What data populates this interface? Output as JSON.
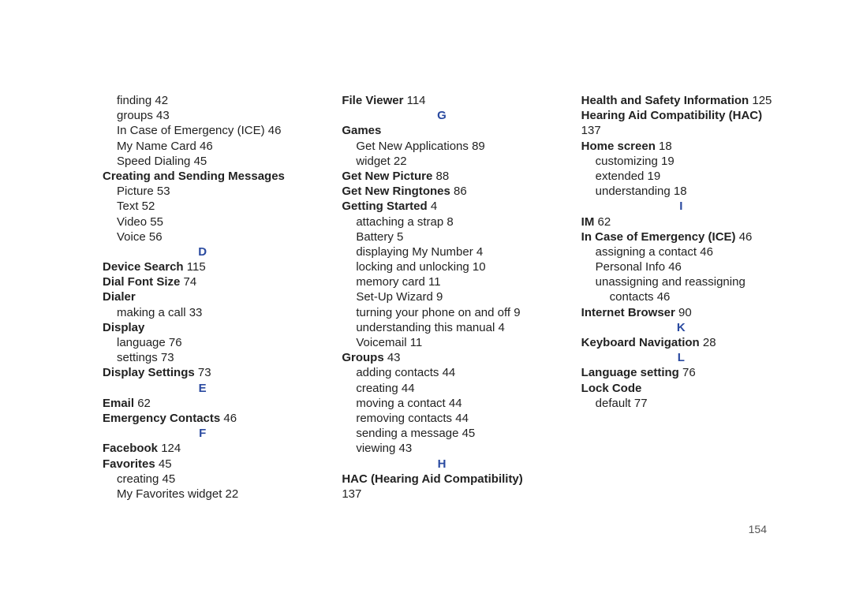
{
  "page_number": "154",
  "lines": [
    {
      "indent": 1,
      "bold": false,
      "letter": false,
      "text": "finding",
      "page": "42"
    },
    {
      "indent": 1,
      "bold": false,
      "letter": false,
      "text": "groups",
      "page": "43"
    },
    {
      "indent": 1,
      "bold": false,
      "letter": false,
      "text": "In Case of Emergency (ICE)",
      "page": "46"
    },
    {
      "indent": 1,
      "bold": false,
      "letter": false,
      "text": "My Name Card",
      "page": "46"
    },
    {
      "indent": 1,
      "bold": false,
      "letter": false,
      "text": "Speed Dialing",
      "page": "45"
    },
    {
      "indent": 0,
      "bold": true,
      "letter": false,
      "text": "Creating and Sending Messages",
      "page": ""
    },
    {
      "indent": 1,
      "bold": false,
      "letter": false,
      "text": "Picture",
      "page": "53"
    },
    {
      "indent": 1,
      "bold": false,
      "letter": false,
      "text": "Text",
      "page": "52"
    },
    {
      "indent": 1,
      "bold": false,
      "letter": false,
      "text": "Video",
      "page": "55"
    },
    {
      "indent": 1,
      "bold": false,
      "letter": false,
      "text": "Voice",
      "page": "56"
    },
    {
      "indent": 0,
      "bold": true,
      "letter": true,
      "text": "D",
      "page": ""
    },
    {
      "indent": 0,
      "bold": true,
      "letter": false,
      "text": "Device Search",
      "page": "115"
    },
    {
      "indent": 0,
      "bold": true,
      "letter": false,
      "text": "Dial Font Size",
      "page": "74"
    },
    {
      "indent": 0,
      "bold": true,
      "letter": false,
      "text": "Dialer",
      "page": ""
    },
    {
      "indent": 1,
      "bold": false,
      "letter": false,
      "text": "making a call",
      "page": "33"
    },
    {
      "indent": 0,
      "bold": true,
      "letter": false,
      "text": "Display",
      "page": ""
    },
    {
      "indent": 1,
      "bold": false,
      "letter": false,
      "text": "language",
      "page": "76"
    },
    {
      "indent": 1,
      "bold": false,
      "letter": false,
      "text": "settings",
      "page": "73"
    },
    {
      "indent": 0,
      "bold": true,
      "letter": false,
      "text": "Display Settings",
      "page": "73"
    },
    {
      "indent": 0,
      "bold": true,
      "letter": true,
      "text": "E",
      "page": ""
    },
    {
      "indent": 0,
      "bold": true,
      "letter": false,
      "text": "Email",
      "page": "62"
    },
    {
      "indent": 0,
      "bold": true,
      "letter": false,
      "text": "Emergency Contacts",
      "page": "46"
    },
    {
      "indent": 0,
      "bold": true,
      "letter": true,
      "text": "F",
      "page": ""
    },
    {
      "indent": 0,
      "bold": true,
      "letter": false,
      "text": "Facebook",
      "page": "124"
    },
    {
      "indent": 0,
      "bold": true,
      "letter": false,
      "text": "Favorites",
      "page": "45"
    },
    {
      "indent": 1,
      "bold": false,
      "letter": false,
      "text": "creating",
      "page": "45"
    },
    {
      "indent": 1,
      "bold": false,
      "letter": false,
      "text": "My Favorites widget",
      "page": "22"
    },
    {
      "indent": 0,
      "bold": true,
      "letter": false,
      "text": "File Viewer",
      "page": "114"
    },
    {
      "indent": 0,
      "bold": true,
      "letter": true,
      "text": "G",
      "page": ""
    },
    {
      "indent": 0,
      "bold": true,
      "letter": false,
      "text": "Games",
      "page": ""
    },
    {
      "indent": 1,
      "bold": false,
      "letter": false,
      "text": "Get New Applications",
      "page": "89"
    },
    {
      "indent": 1,
      "bold": false,
      "letter": false,
      "text": "widget",
      "page": "22"
    },
    {
      "indent": 0,
      "bold": true,
      "letter": false,
      "text": "Get New Picture",
      "page": "88"
    },
    {
      "indent": 0,
      "bold": true,
      "letter": false,
      "text": "Get New Ringtones",
      "page": "86"
    },
    {
      "indent": 0,
      "bold": true,
      "letter": false,
      "text": "Getting Started",
      "page": "4"
    },
    {
      "indent": 1,
      "bold": false,
      "letter": false,
      "text": "attaching a strap",
      "page": "8"
    },
    {
      "indent": 1,
      "bold": false,
      "letter": false,
      "text": "Battery",
      "page": "5"
    },
    {
      "indent": 1,
      "bold": false,
      "letter": false,
      "text": "displaying My Number",
      "page": "4"
    },
    {
      "indent": 1,
      "bold": false,
      "letter": false,
      "text": "locking and unlocking",
      "page": "10"
    },
    {
      "indent": 1,
      "bold": false,
      "letter": false,
      "text": "memory card",
      "page": "11"
    },
    {
      "indent": 1,
      "bold": false,
      "letter": false,
      "text": "Set-Up Wizard",
      "page": "9"
    },
    {
      "indent": 1,
      "bold": false,
      "letter": false,
      "text": "turning your phone on and off",
      "page": "9"
    },
    {
      "indent": 1,
      "bold": false,
      "letter": false,
      "text": "understanding this manual",
      "page": "4"
    },
    {
      "indent": 1,
      "bold": false,
      "letter": false,
      "text": "Voicemail",
      "page": "11"
    },
    {
      "indent": 0,
      "bold": true,
      "letter": false,
      "text": "Groups",
      "page": "43"
    },
    {
      "indent": 1,
      "bold": false,
      "letter": false,
      "text": "adding contacts",
      "page": "44"
    },
    {
      "indent": 1,
      "bold": false,
      "letter": false,
      "text": "creating",
      "page": "44"
    },
    {
      "indent": 1,
      "bold": false,
      "letter": false,
      "text": "moving a contact",
      "page": "44"
    },
    {
      "indent": 1,
      "bold": false,
      "letter": false,
      "text": "removing contacts",
      "page": "44"
    },
    {
      "indent": 1,
      "bold": false,
      "letter": false,
      "text": "sending a message",
      "page": "45"
    },
    {
      "indent": 1,
      "bold": false,
      "letter": false,
      "text": "viewing",
      "page": "43"
    },
    {
      "indent": 0,
      "bold": true,
      "letter": true,
      "text": "H",
      "page": ""
    },
    {
      "indent": 0,
      "bold": true,
      "letter": false,
      "text": "HAC (Hearing Aid Compatibility)",
      "page": "137"
    },
    {
      "indent": 0,
      "bold": true,
      "letter": false,
      "text": "Health and Safety Information",
      "page": "125"
    },
    {
      "indent": 0,
      "bold": true,
      "letter": false,
      "text": "Hearing Aid Compatibility (HAC)",
      "page": "137"
    },
    {
      "indent": 0,
      "bold": true,
      "letter": false,
      "text": "Home screen",
      "page": "18"
    },
    {
      "indent": 1,
      "bold": false,
      "letter": false,
      "text": "customizing",
      "page": "19"
    },
    {
      "indent": 1,
      "bold": false,
      "letter": false,
      "text": "extended",
      "page": "19"
    },
    {
      "indent": 1,
      "bold": false,
      "letter": false,
      "text": "understanding",
      "page": "18"
    },
    {
      "indent": 0,
      "bold": true,
      "letter": true,
      "text": "I",
      "page": ""
    },
    {
      "indent": 0,
      "bold": true,
      "letter": false,
      "text": "IM",
      "page": "62"
    },
    {
      "indent": 0,
      "bold": true,
      "letter": false,
      "text": "In Case of Emergency (ICE)",
      "page": "46"
    },
    {
      "indent": 1,
      "bold": false,
      "letter": false,
      "text": "assigning a contact",
      "page": "46"
    },
    {
      "indent": 1,
      "bold": false,
      "letter": false,
      "text": "Personal Info",
      "page": "46"
    },
    {
      "indent": 1,
      "bold": false,
      "letter": false,
      "text": "unassigning and reassigning",
      "page": ""
    },
    {
      "indent": 2,
      "bold": false,
      "letter": false,
      "text": "contacts",
      "page": "46"
    },
    {
      "indent": 0,
      "bold": true,
      "letter": false,
      "text": "Internet Browser",
      "page": "90"
    },
    {
      "indent": 0,
      "bold": true,
      "letter": true,
      "text": "K",
      "page": ""
    },
    {
      "indent": 0,
      "bold": true,
      "letter": false,
      "text": "Keyboard Navigation",
      "page": "28"
    },
    {
      "indent": 0,
      "bold": true,
      "letter": true,
      "text": "L",
      "page": ""
    },
    {
      "indent": 0,
      "bold": true,
      "letter": false,
      "text": "Language setting",
      "page": "76"
    },
    {
      "indent": 0,
      "bold": true,
      "letter": false,
      "text": "Lock Code",
      "page": ""
    },
    {
      "indent": 1,
      "bold": false,
      "letter": false,
      "text": "default",
      "page": "77"
    }
  ]
}
